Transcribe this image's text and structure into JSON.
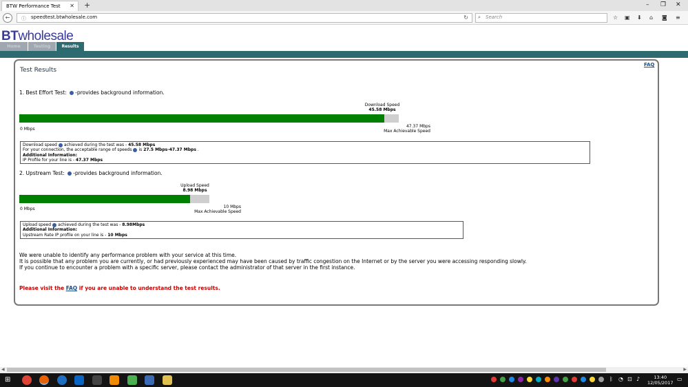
{
  "browser": {
    "tab_title": "BTW Performance Test",
    "url": "speedtest.btwholesale.com",
    "search_placeholder": "Search"
  },
  "site": {
    "logo_prefix": "BT",
    "logo_suffix": "wholesale",
    "tabs": [
      "Home",
      "Testing",
      "Results"
    ],
    "active_tab": "Results",
    "header_color": "#2d6b70"
  },
  "page": {
    "title": "Test Results",
    "faq": "FAQ",
    "best_effort": {
      "heading_prefix": "1. Best Effort Test:",
      "heading_suffix": "-provides background information.",
      "bar_label": "Download Speed",
      "bar_value": "45.58 Mbps",
      "min_label": "0 Mbps",
      "max_value": "47.37 Mbps",
      "max_label": "Max Achievable Speed",
      "fill_fraction": 0.962,
      "info_line1_prefix": "Download speed",
      "info_line1_suffix": "achieved during the test was - ",
      "info_line1_value": "45.58 Mbps",
      "info_line2_prefix": "For your connection, the acceptable range of speeds",
      "info_line2_suffix": "is ",
      "info_line2_value": "27.5 Mbps-47.37 Mbps",
      "info_line2_end": " .",
      "info_line3": "Additional Information:",
      "info_line4_prefix": "IP Profile for your line is - ",
      "info_line4_value": "47.37 Mbps"
    },
    "upstream": {
      "heading_prefix": "2. Upstream Test:",
      "heading_suffix": "-provides background information.",
      "bar_label": "Upload Speed",
      "bar_value": "8.98 Mbps",
      "min_label": "0 Mbps",
      "max_value": "10 Mbps",
      "max_label": "Max Achievable Speed",
      "fill_fraction": 0.898,
      "info_line1_prefix": "Upload speed",
      "info_line1_suffix": "achieved during the test was - ",
      "info_line1_value": "8.98Mbps",
      "info_line2": "Additional Information:",
      "info_line3_prefix": "Upstream Rate IP profile on your line is - ",
      "info_line3_value": "10 Mbps"
    },
    "message_lines": [
      "We were unable to identify any performance problem with your service at this time.",
      "It is possible that any problem you are currently, or had previously experienced may have been caused by traffic congestion on the Internet or by the server you were accessing responding slowly.",
      "If you continue to encounter a problem with a specific server, please contact the administrator of that server in the first instance."
    ],
    "visit_prefix": "Please visit the ",
    "visit_link": "FAQ",
    "visit_suffix": " if you are unable to understand the test results."
  },
  "taskbar": {
    "time": "13:40",
    "date": "12/05/2017"
  }
}
